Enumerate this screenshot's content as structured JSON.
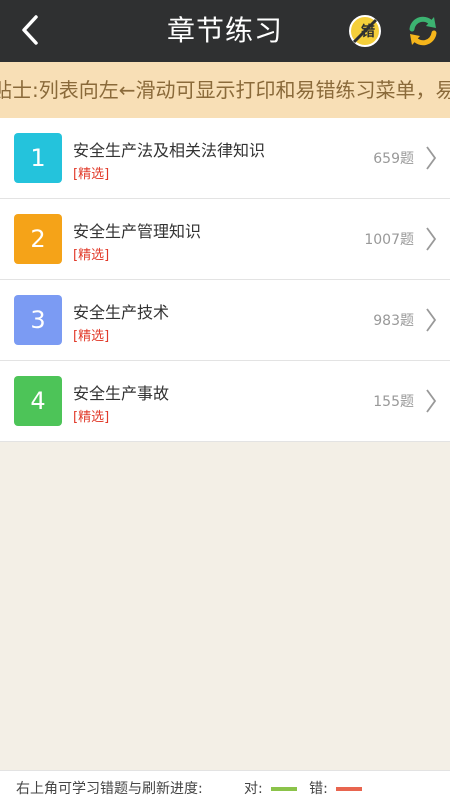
{
  "header": {
    "title": "章节练习",
    "back_icon": "chevron-left-icon",
    "error_book_label": "错",
    "error_book_icon": "error-book-icon",
    "refresh_icon": "refresh-icon"
  },
  "tip": {
    "text": "贴士:列表向左←滑动可显示打印和易错练习菜单，易"
  },
  "chapters": [
    {
      "index": "1",
      "name": "安全生产法及相关法律知识",
      "tag": "[精选]",
      "count": "659题",
      "color": "#24c3dc"
    },
    {
      "index": "2",
      "name": "安全生产管理知识",
      "tag": "[精选]",
      "count": "1007题",
      "color": "#f5a318"
    },
    {
      "index": "3",
      "name": "安全生产技术",
      "tag": "[精选]",
      "count": "983题",
      "color": "#7b9bf3"
    },
    {
      "index": "4",
      "name": "安全生产事故",
      "tag": "[精选]",
      "count": "155题",
      "color": "#4dc458"
    }
  ],
  "footer": {
    "hint": "右上角可学习错题与刷新进度:",
    "correct_label": "对:",
    "wrong_label": "错:",
    "correct_color": "#8bc34a",
    "wrong_color": "#e8654f"
  }
}
